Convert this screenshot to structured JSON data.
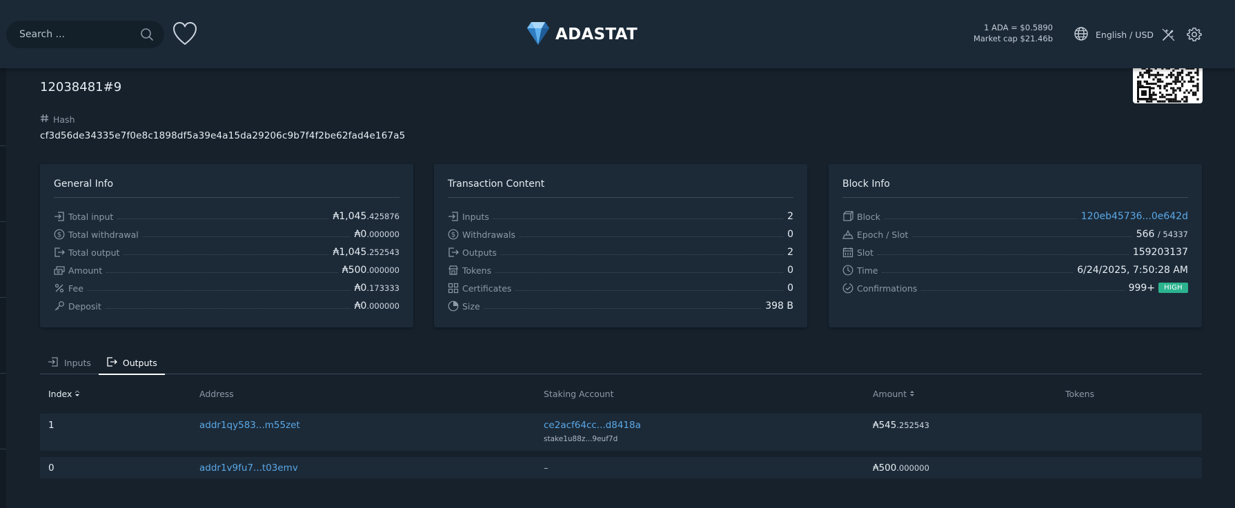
{
  "header": {
    "search_placeholder": "Search ...",
    "brand": "ADASTAT",
    "price": "1 ADA = $0.5890",
    "market_cap": "Market cap $21.46b",
    "language": "English / USD"
  },
  "tx": {
    "title": "12038481#9",
    "hash_label": "Hash",
    "hash": "cf3d56de34335e7f0e8c1898df5a39e4a15da29206c9b7f4f2be62fad4e167a5"
  },
  "general_info": {
    "title": "General Info",
    "rows": [
      {
        "label": "Total input",
        "main": "₳1,045",
        "small": ".425876"
      },
      {
        "label": "Total withdrawal",
        "main": "₳0",
        "small": ".000000"
      },
      {
        "label": "Total output",
        "main": "₳1,045",
        "small": ".252543"
      },
      {
        "label": "Amount",
        "main": "₳500",
        "small": ".000000"
      },
      {
        "label": "Fee",
        "main": "₳0",
        "small": ".173333"
      },
      {
        "label": "Deposit",
        "main": "₳0",
        "small": ".000000"
      }
    ]
  },
  "transaction_content": {
    "title": "Transaction Content",
    "rows": [
      {
        "label": "Inputs",
        "value": "2"
      },
      {
        "label": "Withdrawals",
        "value": "0"
      },
      {
        "label": "Outputs",
        "value": "2"
      },
      {
        "label": "Tokens",
        "value": "0"
      },
      {
        "label": "Certificates",
        "value": "0"
      },
      {
        "label": "Size",
        "value": "398 B"
      }
    ]
  },
  "block_info": {
    "title": "Block Info",
    "block_label": "Block",
    "block_value": "120eb45736...0e642d",
    "epoch_label": "Epoch / Slot",
    "epoch_value": "566",
    "epoch_slot": "/ 54337",
    "slot_label": "Slot",
    "slot_value": "159203137",
    "time_label": "Time",
    "time_value": "6/24/2025, 7:50:28 AM",
    "confirmations_label": "Confirmations",
    "confirmations_value": "999+",
    "confirmations_badge": "HIGH"
  },
  "tabs": {
    "inputs": "Inputs",
    "outputs": "Outputs"
  },
  "table": {
    "columns": {
      "index": "Index",
      "address": "Address",
      "staking": "Staking Account",
      "amount": "Amount",
      "tokens": "Tokens"
    },
    "rows": [
      {
        "index": "1",
        "address": "addr1qy583...m55zet",
        "staking": "ce2acf64cc...d8418a",
        "staking_sub": "stake1u88z...9euf7d",
        "amount_main": "₳545",
        "amount_small": ".252543"
      },
      {
        "index": "0",
        "address": "addr1v9fu7...t03emv",
        "staking": "–",
        "amount_main": "₳500",
        "amount_small": ".000000"
      }
    ]
  },
  "colors": {
    "background": "#16212c",
    "card": "#1c2a38",
    "link": "#5aa8e6",
    "badge_high": "#2bb38f"
  }
}
